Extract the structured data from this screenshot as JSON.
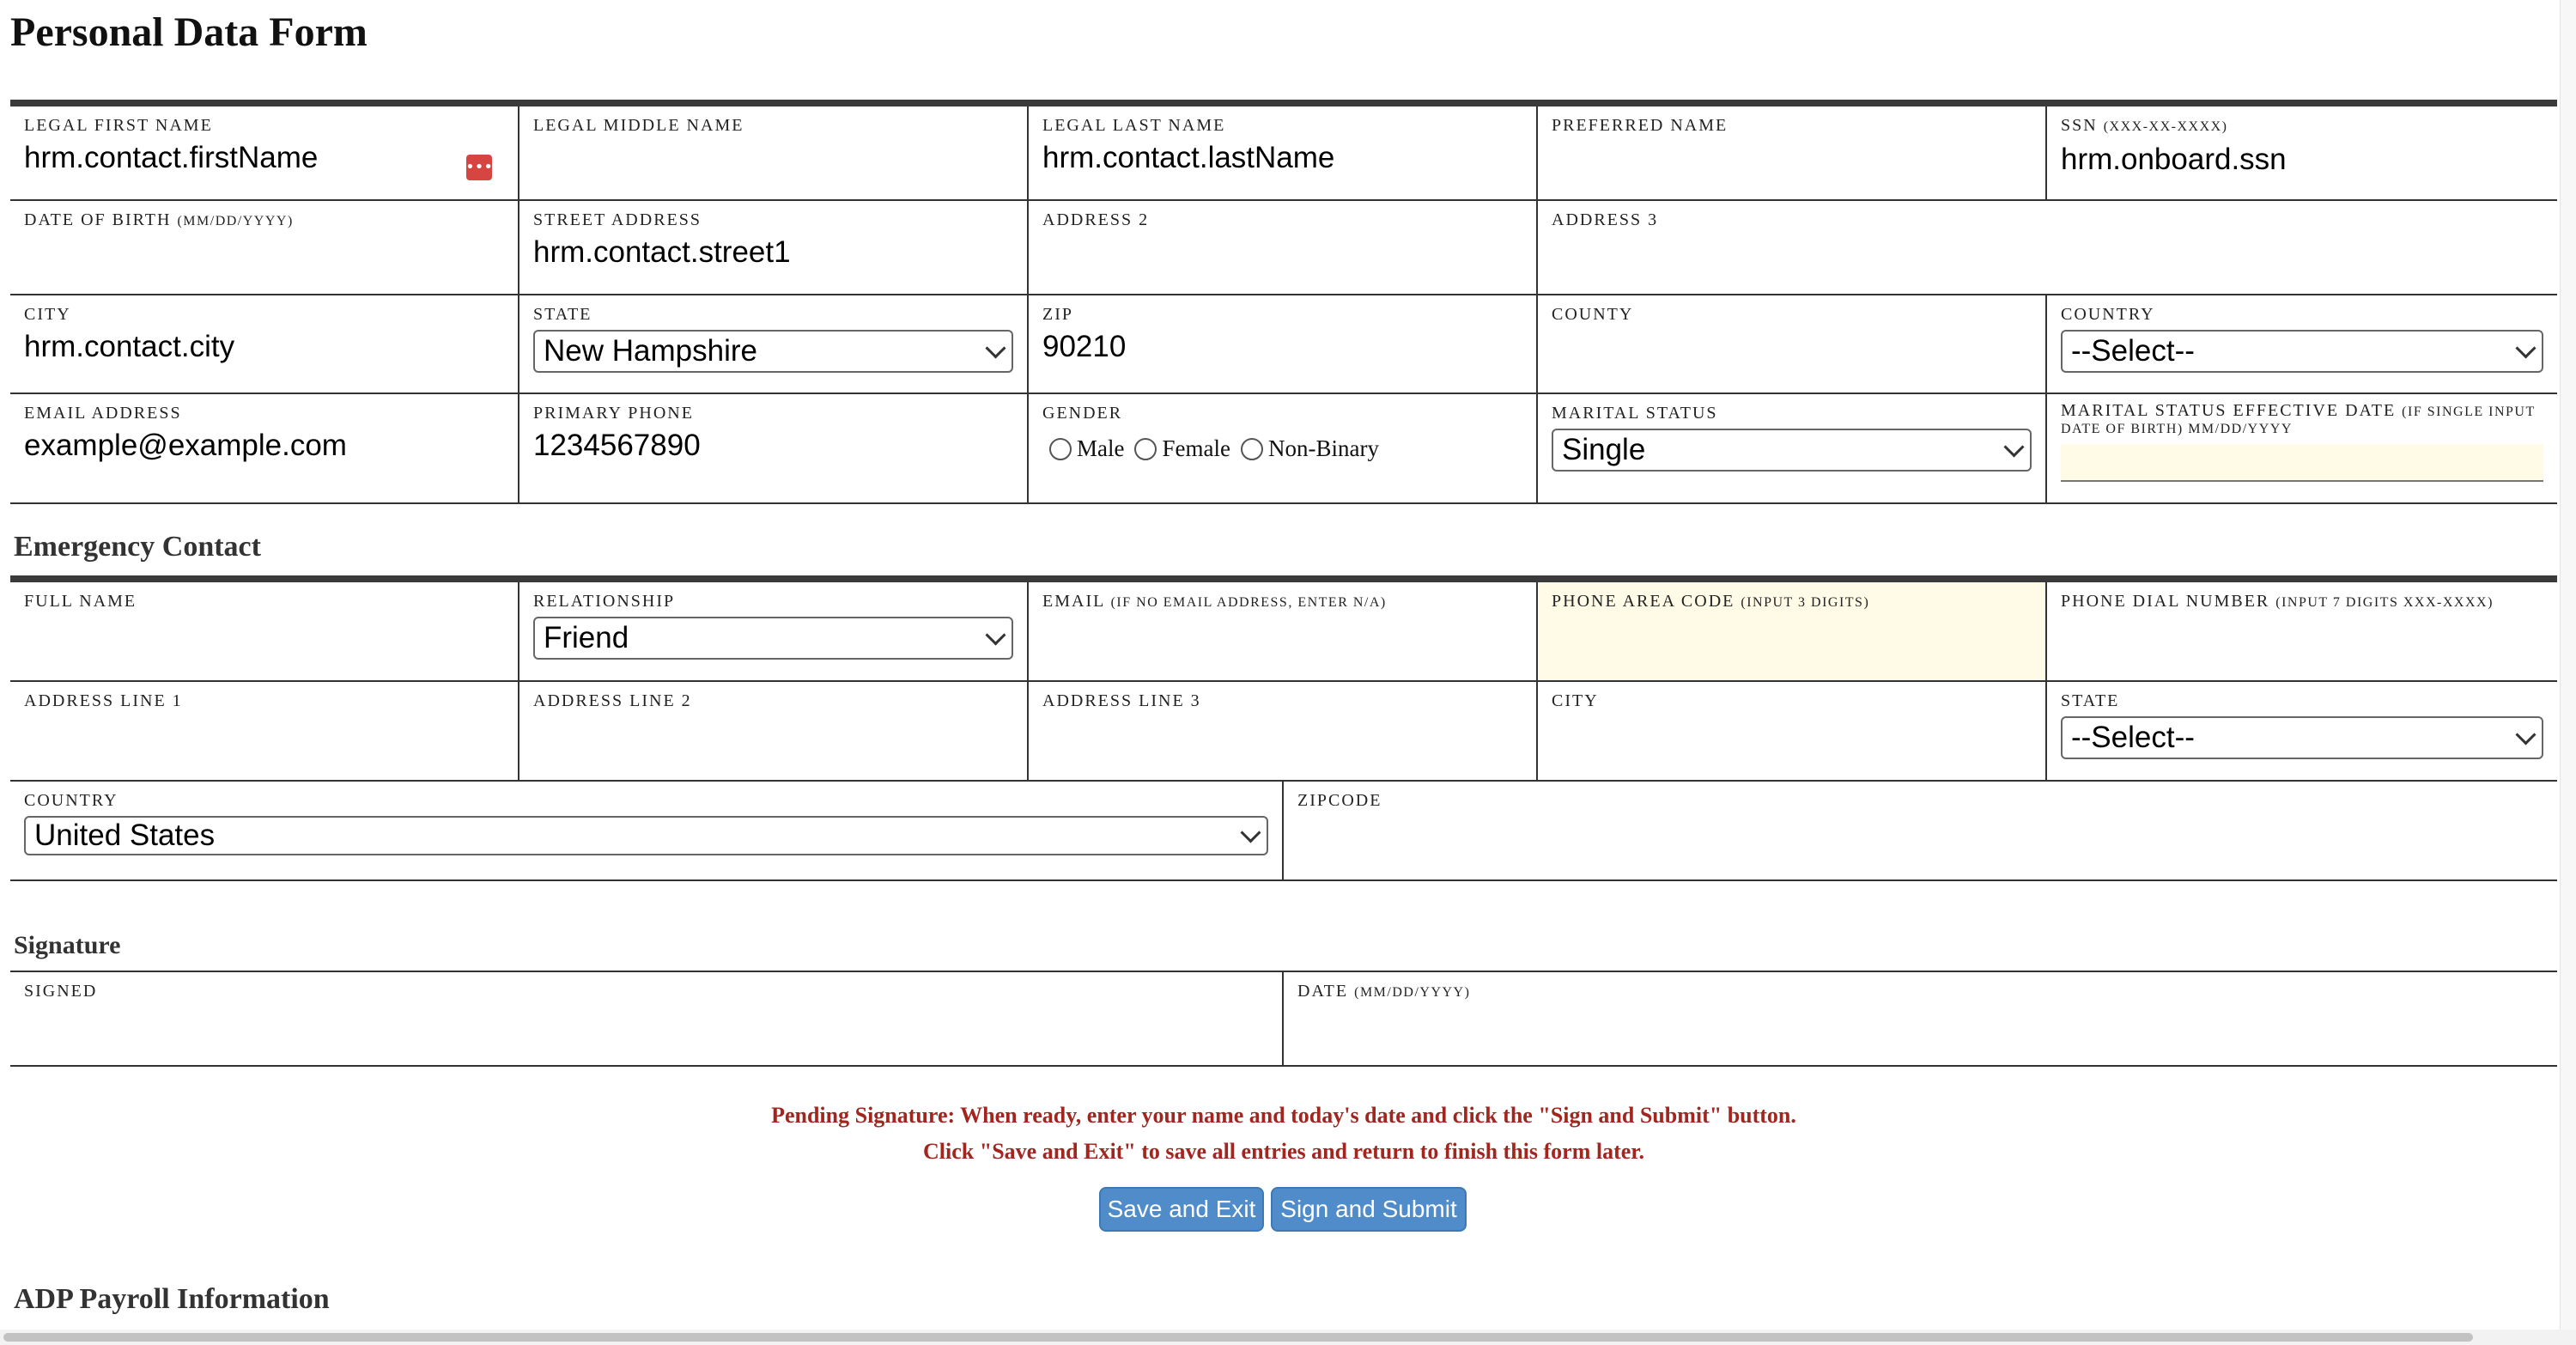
{
  "title": "Personal Data Form",
  "personal": {
    "row1": [
      {
        "label": "Legal First Name",
        "hint": "",
        "value": "hrm.contact.firstName"
      },
      {
        "label": "Legal Middle Name",
        "hint": "",
        "value": ""
      },
      {
        "label": "Legal Last Name",
        "hint": "",
        "value": "hrm.contact.lastName"
      },
      {
        "label": "Preferred Name",
        "hint": "",
        "value": ""
      },
      {
        "label": "SSN",
        "hint": "(XXX-XX-XXXX)",
        "value": "hrm.onboard.ssn"
      }
    ],
    "row2": [
      {
        "label": "Date of Birth",
        "hint": "(MM/DD/YYYY)",
        "value": ""
      },
      {
        "label": "Street Address",
        "hint": "",
        "value": "hrm.contact.street1"
      },
      {
        "label": "Address 2",
        "hint": "",
        "value": ""
      },
      {
        "label": "Address 3",
        "hint": "",
        "value": ""
      }
    ],
    "row3": {
      "city_label": "City",
      "city_value": "hrm.contact.city",
      "state_label": "State",
      "state_value": "New Hampshire",
      "zip_label": "Zip",
      "zip_value": "90210",
      "county_label": "County",
      "county_value": "",
      "country_label": "Country",
      "country_value": "--Select--"
    },
    "row4": {
      "email_label": "Email Address",
      "email_value": "example@example.com",
      "phone_label": "Primary Phone",
      "phone_value": "1234567890",
      "gender_label": "Gender",
      "gender_options": [
        "Male",
        "Female",
        "Non-Binary"
      ],
      "marital_label": "Marital Status",
      "marital_value": "Single",
      "marital_date_label": "Marital Status Effective Date",
      "marital_date_hint": "(IF SINGLE INPUT DATE OF BIRTH) MM/DD/YYYY"
    }
  },
  "emergency": {
    "section_title": "Emergency Contact",
    "row1": {
      "fullname_label": "Full Name",
      "relationship_label": "Relationship",
      "relationship_value": "Friend",
      "email_label": "Email",
      "email_hint": "(IF NO EMAIL ADDRESS, ENTER N/A)",
      "area_label": "Phone Area Code",
      "area_hint": "(INPUT 3 DIGITS)",
      "dial_label": "Phone Dial Number",
      "dial_hint": "(INPUT 7 DIGITS XXX-XXXX)"
    },
    "row2": {
      "addr1_label": "Address Line 1",
      "addr2_label": "Address Line 2",
      "addr3_label": "Address Line 3",
      "city_label": "City",
      "state_label": "State",
      "state_value": "--Select--"
    },
    "row3": {
      "country_label": "Country",
      "country_value": "United States",
      "zip_label": "Zipcode"
    }
  },
  "signature": {
    "section_title": "Signature",
    "signed_label": "Signed",
    "date_label": "Date",
    "date_hint": "(MM/DD/YYYY)"
  },
  "message": {
    "line1": "Pending Signature: When ready, enter your name and today's date and click the \"Sign and Submit\" button.",
    "line2": "Click \"Save and Exit\" to save all entries and return to finish this form later."
  },
  "buttons": {
    "save_exit": "Save and Exit",
    "sign_submit": "Sign and Submit"
  },
  "payroll": {
    "section_title": "ADP Payroll Information"
  },
  "icons": {
    "password_manager": "password-manager-icon"
  }
}
